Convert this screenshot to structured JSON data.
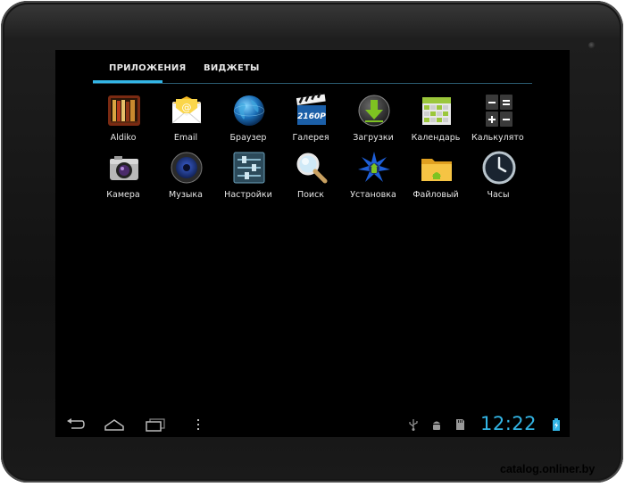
{
  "tabs": {
    "apps_label": "ПРИЛОЖЕНИЯ",
    "widgets_label": "ВИДЖЕТЫ",
    "active": "apps"
  },
  "apps_row1": [
    {
      "label": "Aldiko",
      "icon": "books-icon"
    },
    {
      "label": "Email",
      "icon": "email-icon"
    },
    {
      "label": "Браузер",
      "icon": "globe-icon"
    },
    {
      "label": "Галерея",
      "icon": "clapperboard-icon"
    },
    {
      "label": "Загрузки",
      "icon": "download-icon"
    },
    {
      "label": "Календарь",
      "icon": "calendar-icon"
    },
    {
      "label": "Калькулято",
      "icon": "calculator-icon"
    }
  ],
  "apps_row2": [
    {
      "label": "Камера",
      "icon": "camera-icon"
    },
    {
      "label": "Музыка",
      "icon": "speaker-icon"
    },
    {
      "label": "Настройки",
      "icon": "sliders-icon"
    },
    {
      "label": "Поиск",
      "icon": "magnifier-icon"
    },
    {
      "label": "Установка",
      "icon": "installer-icon"
    },
    {
      "label": "Файловый",
      "icon": "folder-icon"
    },
    {
      "label": "Часы",
      "icon": "clock-icon"
    }
  ],
  "gallery_badge": "2160P",
  "status": {
    "time": "12:22"
  },
  "watermark": "catalog.onliner.by",
  "colors": {
    "accent": "#33b5e5",
    "screen": "#000000",
    "bezel": "#1a1a1a"
  }
}
